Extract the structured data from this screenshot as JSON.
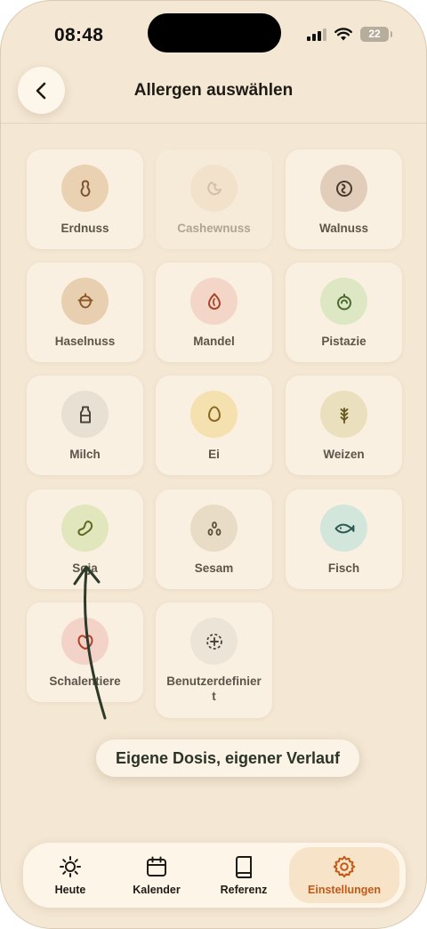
{
  "status_bar": {
    "time": "08:48",
    "battery": "22"
  },
  "header": {
    "title": "Allergen auswählen",
    "back_icon": "chevron-left-icon"
  },
  "allergens": [
    {
      "label": "Erdnuss",
      "icon": "peanut-icon",
      "circle_color": "#ead1b1",
      "icon_color": "#7a5532",
      "disabled": false
    },
    {
      "label": "Cashewnuss",
      "icon": "cashew-icon",
      "circle_color": "#f2dcc2",
      "icon_color": "#b09070",
      "disabled": true
    },
    {
      "label": "Walnuss",
      "icon": "walnut-icon",
      "circle_color": "#e2cdbb",
      "icon_color": "#4a3a2e",
      "disabled": false
    },
    {
      "label": "Haselnuss",
      "icon": "hazelnut-icon",
      "circle_color": "#e8cfaf",
      "icon_color": "#8a5a2b",
      "disabled": false
    },
    {
      "label": "Mandel",
      "icon": "almond-icon",
      "circle_color": "#f3d6c8",
      "icon_color": "#a4472b",
      "disabled": false
    },
    {
      "label": "Pistazie",
      "icon": "pistachio-icon",
      "circle_color": "#dde7c3",
      "icon_color": "#4c6a2f",
      "disabled": false
    },
    {
      "label": "Milch",
      "icon": "milk-bottle-icon",
      "circle_color": "#e8e0d2",
      "icon_color": "#4a453c",
      "disabled": false
    },
    {
      "label": "Ei",
      "icon": "egg-icon",
      "circle_color": "#f5e0b0",
      "icon_color": "#8a6a1f",
      "disabled": false
    },
    {
      "label": "Weizen",
      "icon": "wheat-icon",
      "circle_color": "#ebe0bd",
      "icon_color": "#6a5a22",
      "disabled": false
    },
    {
      "label": "Soja",
      "icon": "soybean-icon",
      "circle_color": "#e1e6bd",
      "icon_color": "#5e6a22",
      "disabled": false
    },
    {
      "label": "Sesam",
      "icon": "sesame-icon",
      "circle_color": "#e8dcc6",
      "icon_color": "#5a4e3c",
      "disabled": false
    },
    {
      "label": "Fisch",
      "icon": "fish-icon",
      "circle_color": "#d3e6dc",
      "icon_color": "#2f5a52",
      "disabled": false
    },
    {
      "label": "Schalentiere",
      "icon": "shellfish-icon",
      "circle_color": "#f3d2c8",
      "icon_color": "#b2412c",
      "disabled": false
    },
    {
      "label": "Benutzerdefiniert",
      "icon": "add-custom-icon",
      "circle_color": "#ece4d6",
      "icon_color": "#4a453c",
      "disabled": false
    }
  ],
  "annotation": {
    "text": "Eigene Dosis, eigener Verlauf"
  },
  "tabbar": {
    "tabs": [
      {
        "label": "Heute",
        "icon": "sun-icon",
        "active": false
      },
      {
        "label": "Kalender",
        "icon": "calendar-icon",
        "active": false
      },
      {
        "label": "Referenz",
        "icon": "book-icon",
        "active": false
      },
      {
        "label": "Einstellungen",
        "icon": "gear-icon",
        "active": true
      }
    ],
    "active_color": "#c25a17"
  }
}
